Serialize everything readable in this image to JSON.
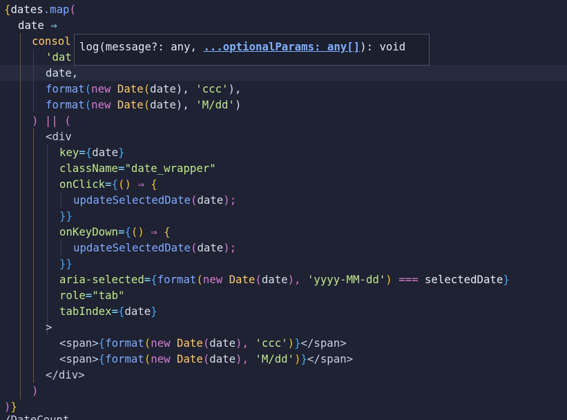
{
  "colors": {
    "background": "#1e2233",
    "bracket_yellow": "#f1c232",
    "bracket_pink": "#d77bd0",
    "bracket_blue": "#4fa3f0",
    "function": "#82aaff",
    "string": "#c3e88d",
    "class": "#ffcb6b"
  },
  "code": {
    "l1": {
      "a": "{",
      "b": "dates",
      "c": ".map",
      "d": "("
    },
    "l2": {
      "a": "date",
      "b": " ⇒"
    },
    "l3": {
      "a": "consol"
    },
    "l4": {
      "a": "'dat"
    },
    "l5": {
      "a": "date,"
    },
    "l6": {
      "a": "format",
      "b": "(",
      "c": "new ",
      "d": "Date",
      "e": "(",
      "f": "date",
      "g": "), ",
      "h": "'ccc'",
      "i": "),"
    },
    "l7": {
      "a": "format",
      "b": "(",
      "c": "new ",
      "d": "Date",
      "e": "(",
      "f": "date",
      "g": "), ",
      "h": "'M/dd'",
      "i": ")"
    },
    "l8": {
      "a": ")",
      "b": " || ",
      "c": "("
    },
    "l9": {
      "a": "<div"
    },
    "l10": {
      "a": "key",
      "b": "=",
      "c": "{",
      "d": "date",
      "e": "}"
    },
    "l11": {
      "a": "className",
      "b": "=",
      "c": "\"date_wrapper\""
    },
    "l12": {
      "a": "onClick",
      "b": "=",
      "c": "{",
      "d": "()",
      "e": " ⇒ ",
      "f": "{"
    },
    "l13": {
      "a": "updateSelectedDate",
      "b": "(",
      "c": "date",
      "d": ");"
    },
    "l14": {
      "a": "}}"
    },
    "l15": {
      "a": "onKeyDown",
      "b": "=",
      "c": "{",
      "d": "()",
      "e": " ⇒ ",
      "f": "{"
    },
    "l16": {
      "a": "updateSelectedDate",
      "b": "(",
      "c": "date",
      "d": ");"
    },
    "l17": {
      "a": "}}"
    },
    "l18": {
      "a": "aria-selected",
      "b": "=",
      "c": "{",
      "d": "format",
      "e": "(",
      "f": "new ",
      "g": "Date",
      "h": "(",
      "i": "date",
      "j": "), ",
      "k": "'yyyy-MM-dd'",
      "l": ")",
      "m": " === ",
      "n": "selectedDate",
      "o": "}"
    },
    "l19": {
      "a": "role",
      "b": "=",
      "c": "\"tab\""
    },
    "l20": {
      "a": "tabIndex",
      "b": "=",
      "c": "{",
      "d": "date",
      "e": "}"
    },
    "l21": {
      "a": ">"
    },
    "l22": {
      "a": "<span>",
      "b": "{",
      "c": "format",
      "d": "(",
      "e": "new ",
      "f": "Date",
      "g": "(",
      "h": "date",
      "i": "), ",
      "j": "'ccc'",
      "k": ")",
      "l": "}",
      "m": "</span>"
    },
    "l23": {
      "a": "<span>",
      "b": "{",
      "c": "format",
      "d": "(",
      "e": "new ",
      "f": "Date",
      "g": "(",
      "h": "date",
      "i": "), ",
      "j": "'M/dd'",
      "k": ")",
      "l": "}",
      "m": "</span>"
    },
    "l24": {
      "a": "</div>"
    },
    "l25": {
      "a": ")"
    },
    "l26": {
      "a": ")",
      "b": "}"
    },
    "l27": {
      "a": "/DateCount"
    }
  },
  "tooltip": {
    "pre": "log(message?: any, ",
    "active": "...optionalParams: any[]",
    "post": "): void"
  }
}
